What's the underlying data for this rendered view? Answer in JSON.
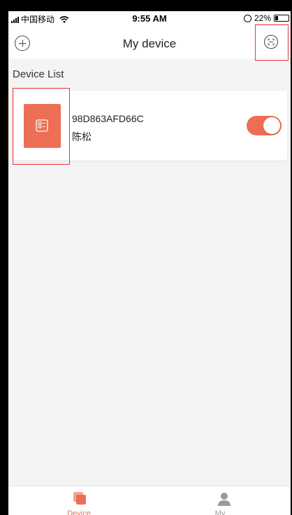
{
  "status_bar": {
    "carrier": "中国移动",
    "time": "9:55 AM",
    "battery": "22%",
    "battery_level": 0.22
  },
  "nav": {
    "title": "My device",
    "left_icon": "add-circle-icon",
    "right_icon": "scan-icon"
  },
  "section": {
    "title": "Device List"
  },
  "devices": [
    {
      "id": "98D863AFD66C",
      "name": "陈松",
      "on": true,
      "icon": "device-chip-icon"
    }
  ],
  "tabs": [
    {
      "label": "Device",
      "icon": "device-tab-icon",
      "active": true
    },
    {
      "label": "My",
      "icon": "person-icon",
      "active": false
    }
  ],
  "colors": {
    "accent": "#ec6f55",
    "highlight_box": "#e33333",
    "background": "#f4f4f4"
  }
}
